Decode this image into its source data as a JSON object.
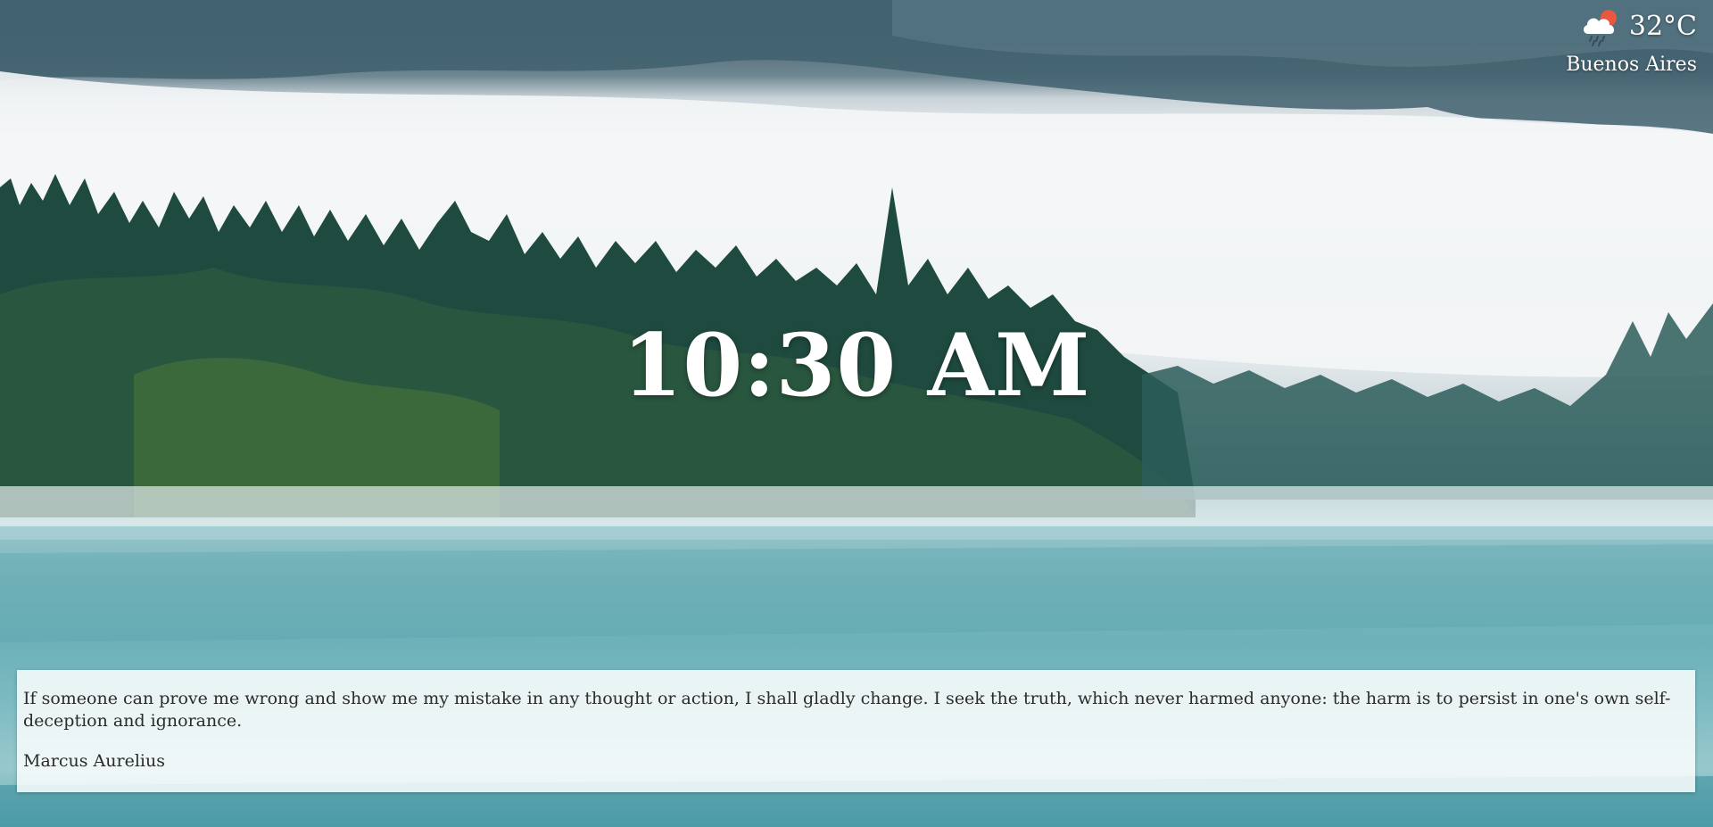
{
  "background": {
    "description_icon": "misty-lake-forest-photo"
  },
  "weather": {
    "icon": "cloud-rain-sun-icon",
    "temperature": "32°C",
    "city": "Buenos Aires",
    "icon_colors": {
      "sun": "#e9573f",
      "cloud": "#ffffff",
      "rain": "#3c4a5c"
    }
  },
  "clock": {
    "time": "10:30 AM"
  },
  "quote": {
    "text": "If someone can prove me wrong and show me my mistake in any thought or action, I shall gladly change. I seek the truth, which never harmed anyone: the harm is to persist in one's own self-deception and ignorance.",
    "author": "Marcus Aurelius"
  }
}
